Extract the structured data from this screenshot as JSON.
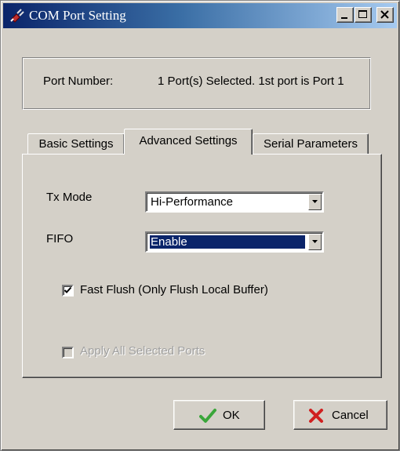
{
  "window": {
    "title": "COM Port Setting",
    "icon": "plug-icon",
    "controls": [
      "minimize-icon",
      "maximize-icon",
      "close-icon"
    ]
  },
  "port": {
    "label": "Port Number:",
    "value": "1 Port(s) Selected. 1st port is Port 1"
  },
  "tabs": [
    {
      "label": "Basic Settings",
      "active": false
    },
    {
      "label": "Advanced Settings",
      "active": true
    },
    {
      "label": "Serial Parameters",
      "active": false
    }
  ],
  "advanced": {
    "tx_mode_label": "Tx Mode",
    "tx_mode_value": "Hi-Performance",
    "fifo_label": "FIFO",
    "fifo_value": "Enable",
    "fast_flush_label": "Fast Flush (Only Flush Local Buffer)",
    "fast_flush_checked": true,
    "apply_all_label": "Apply All Selected Ports",
    "apply_all_checked": false,
    "apply_all_enabled": false
  },
  "buttons": {
    "ok_label": "OK",
    "cancel_label": "Cancel"
  },
  "colors": {
    "titlebar_start": "#0a246a",
    "titlebar_end": "#a6caf0",
    "face": "#d4d0c8",
    "selection": "#0a246a",
    "ok_check": "#3aa63a",
    "cancel_x": "#d02020"
  }
}
